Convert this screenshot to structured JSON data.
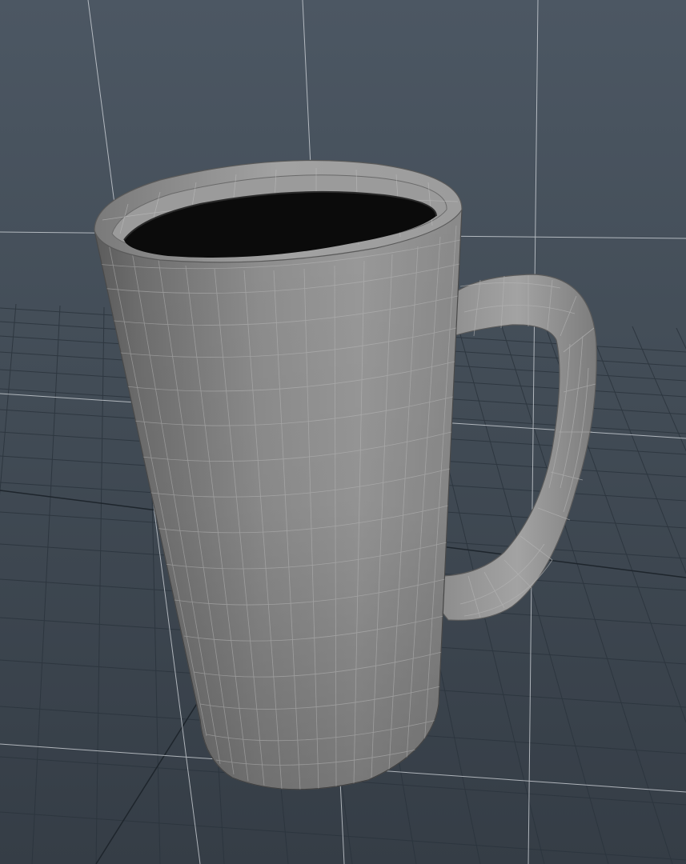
{
  "viewport": {
    "name": "3d-modeling-viewport",
    "background_top": "#4b5561",
    "background_bottom": "#363e47",
    "grid_line_color": "#2a333c",
    "grid_highlight_color": "#c9ced4"
  },
  "scene": {
    "object": "mug",
    "display_mode": "shaded-wireframe",
    "object_color": "#8a8a8a",
    "wire_color": "#a9a9a9",
    "interior_color": "#0b0b0b"
  }
}
